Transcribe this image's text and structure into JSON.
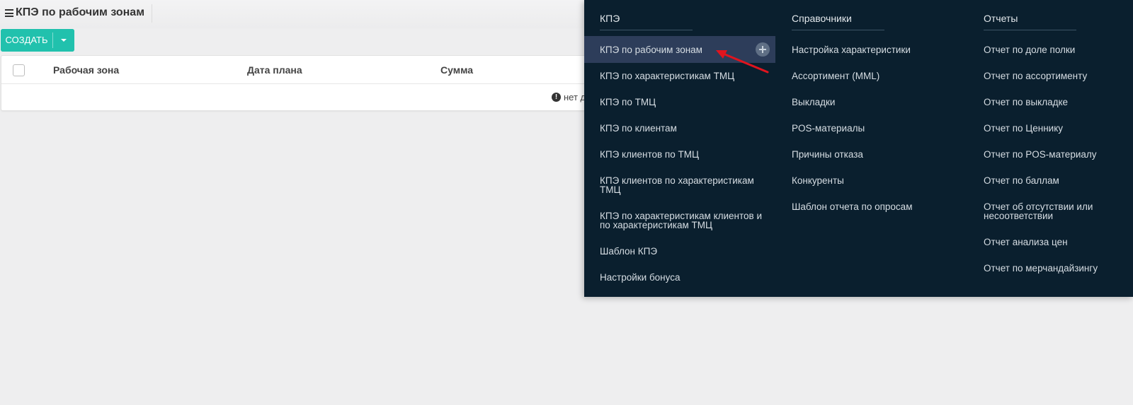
{
  "header": {
    "title": "КПЭ по рабочим зонам"
  },
  "toolbar": {
    "create_label": "СОЗДАТЬ"
  },
  "table": {
    "columns": [
      "Рабочая зона",
      "Дата плана",
      "Сумма"
    ],
    "empty_text": "нет д"
  },
  "menu": {
    "columns": [
      {
        "title": "КПЭ",
        "items": [
          "КПЭ по рабочим зонам",
          "КПЭ по характеристикам ТМЦ",
          "КПЭ по ТМЦ",
          "КПЭ по клиентам",
          "КПЭ клиентов по ТМЦ",
          "КПЭ клиентов по характеристикам ТМЦ",
          "КПЭ по характеристикам клиентов и по характеристикам ТМЦ",
          "Шаблон КПЭ",
          "Настройки бонуса"
        ]
      },
      {
        "title": "Справочники",
        "items": [
          "Настройка характеристики",
          "Ассортимент (MML)",
          "Выкладки",
          "POS-материалы",
          "Причины отказа",
          "Конкуренты",
          "Шаблон отчета по опросам"
        ]
      },
      {
        "title": "Отчеты",
        "items": [
          "Отчет по доле полки",
          "Отчет по ассортименту",
          "Отчет по выкладке",
          "Отчет по Ценнику",
          "Отчет по POS-материалу",
          "Отчет по баллам",
          "Отчет об отсутствии или несоответствии",
          "Отчет анализа цен",
          "Отчет по мерчандайзингу"
        ]
      }
    ]
  },
  "colors": {
    "accent": "#21c1ad",
    "menu_background": "#0a1f2e",
    "menu_active": "#2d3d5a",
    "annotation_arrow": "#e0141e"
  }
}
